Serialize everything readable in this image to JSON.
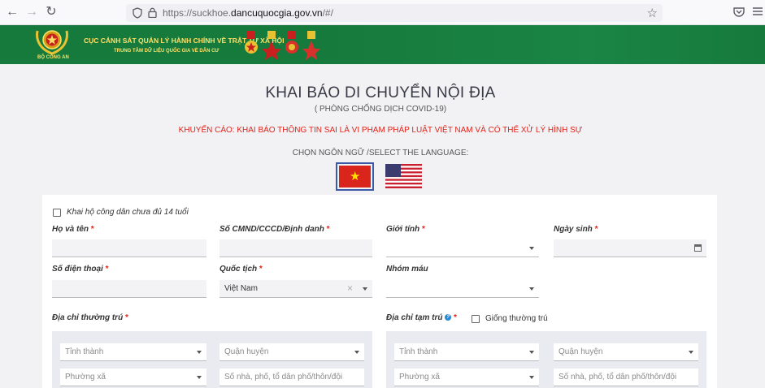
{
  "browser": {
    "url_prefix": "https://suckhoe.",
    "url_domain": "dancuquocgia.gov.vn",
    "url_suffix": "/#/"
  },
  "banner": {
    "emblem_label": "BỘ CÔNG AN",
    "agency_name": "CỤC CẢNH SÁT QUẢN LÝ HÀNH CHÍNH VỀ TRẬT TỰ XÃ HỘI",
    "center_name": "TRUNG TÂM DỮ LIỆU QUỐC GIA VỀ DÂN CƯ"
  },
  "page": {
    "title": "KHAI BÁO DI CHUYỂN NỘI ĐỊA",
    "subtitle": "( PHÒNG CHỐNG DỊCH COVID-19)",
    "warning": "KHUYẾN CÁO: KHAI BÁO THÔNG TIN SAI LÀ VI PHẠM PHÁP LUẬT VIỆT NAM VÀ CÓ THỂ XỬ LÝ HÌNH SỰ",
    "language_label": "CHỌN NGÔN NGỮ /SELECT THE LANGUAGE:"
  },
  "form": {
    "proxy_checkbox_label": "Khai hộ công dân chưa đủ 14 tuổi",
    "full_name_label": "Họ và tên",
    "id_label": "Số CMND/CCCD/Định danh",
    "gender_label": "Giới tính",
    "dob_label": "Ngày sinh",
    "phone_label": "Số điện thoại",
    "nationality_label": "Quốc tịch",
    "nationality_value": "Việt Nam",
    "blood_label": "Nhóm máu",
    "required_mark": "*",
    "permanent_address_label": "Địa chỉ thường trú",
    "temporary_address_label": "Địa chỉ tạm trú",
    "same_as_permanent_label": "Giống thường trú",
    "province_placeholder": "Tỉnh thành",
    "district_placeholder": "Quận huyện",
    "ward_placeholder": "Phường xã",
    "street_placeholder": "Số nhà, phố, tổ dân phố/thôn/đội"
  },
  "colors": {
    "banner_green": "#167a3c",
    "banner_text": "#ffe066",
    "warning_red": "#e0241b",
    "flag_border": "#3b5ba8"
  }
}
